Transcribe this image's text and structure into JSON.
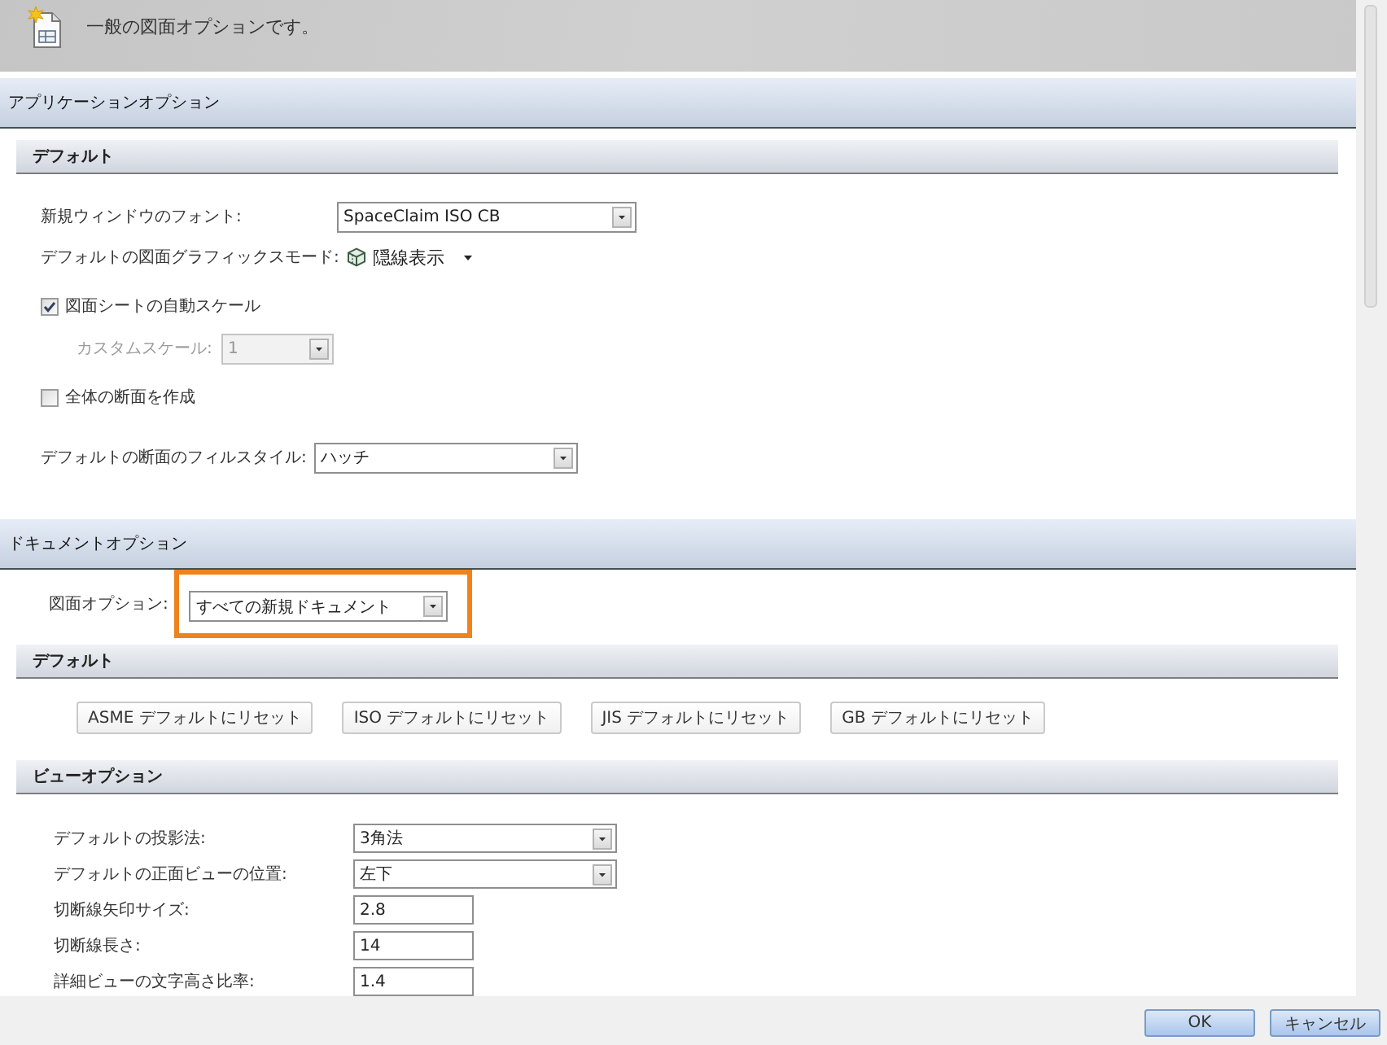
{
  "header": {
    "description": "一般の図面オプションです。"
  },
  "sections": [
    {
      "title": "アプリケーションオプション",
      "groups": [
        {
          "kind": "form",
          "title": "デフォルト",
          "rows": [
            {
              "kind": "dropdown",
              "label": "新規ウィンドウのフォント:",
              "value": "SpaceClaim ISO CB",
              "disabled": false
            },
            {
              "kind": "mode_menu",
              "label": "デフォルトの図面グラフィックスモード:",
              "value": "隠線表示"
            },
            {
              "kind": "checkbox",
              "label": "図面シートの自動スケール",
              "checked": true,
              "children": [
                {
                  "kind": "dropdown",
                  "label": "カスタムスケール:",
                  "value": "1",
                  "disabled": true
                }
              ]
            },
            {
              "kind": "checkbox",
              "label": "全体の断面を作成",
              "checked": false
            },
            {
              "kind": "dropdown",
              "label": "デフォルトの断面のフィルスタイル:",
              "value": "ハッチ",
              "disabled": false
            }
          ]
        }
      ]
    },
    {
      "title": "ドキュメントオプション",
      "scope": {
        "label": "図面オプション:",
        "value": "すべての新規ドキュメント",
        "highlighted": true
      },
      "groups": [
        {
          "kind": "buttons",
          "title": "デフォルト",
          "buttons": [
            "ASME デフォルトにリセット",
            "ISO デフォルトにリセット",
            "JIS デフォルトにリセット",
            "GB デフォルトにリセット"
          ]
        },
        {
          "kind": "form",
          "title": "ビューオプション",
          "rows": [
            {
              "kind": "dropdown",
              "label": "デフォルトの投影法:",
              "value": "3角法",
              "disabled": false
            },
            {
              "kind": "dropdown",
              "label": "デフォルトの正面ビューの位置:",
              "value": "左下",
              "disabled": false
            },
            {
              "kind": "text_input",
              "label": "切断線矢印サイズ:",
              "value": "2.8"
            },
            {
              "kind": "text_input",
              "label": "切断線長さ:",
              "value": "14"
            },
            {
              "kind": "text_input",
              "label": "詳細ビューの文字高さ比率:",
              "value": "1.4"
            }
          ]
        }
      ]
    }
  ],
  "footer": {
    "buttons": [
      "OK",
      "キャンセル"
    ]
  }
}
